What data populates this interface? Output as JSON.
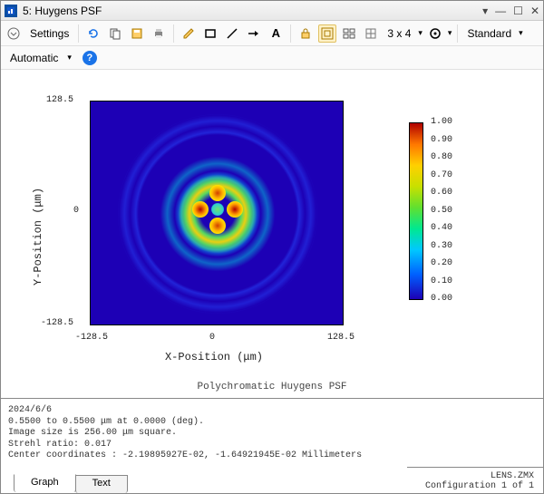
{
  "window": {
    "title": "5: Huygens PSF"
  },
  "toolbar": {
    "settings_label": "Settings",
    "grid_label": "3 x 4",
    "mode_label": "Standard",
    "automatic_label": "Automatic"
  },
  "tabs": {
    "graph": "Graph",
    "text": "Text"
  },
  "info": {
    "date": "2024/6/6",
    "wavelength_line": "0.5500 to 0.5500 μm at 0.0000 (deg).",
    "image_size_line": "Image size is 256.00 μm square.",
    "strehl_line": "Strehl ratio: 0.017",
    "center_line": "Center coordinates :  -2.19895927E-02,  -1.64921945E-02 Millimeters",
    "lens_file": "LENS.ZMX",
    "config_line": "Configuration 1 of 1"
  },
  "plot_caption": "Polychromatic Huygens PSF",
  "chart_data": {
    "type": "heatmap",
    "title": "Polychromatic Huygens PSF",
    "xlabel": "X-Position (μm)",
    "ylabel": "Y-Position (μm)",
    "xlim": [
      -128.5,
      128.5
    ],
    "ylim": [
      -128.5,
      128.5
    ],
    "xticks": [
      -128.5,
      0,
      128.5
    ],
    "yticks": [
      -128.5,
      0,
      128.5
    ],
    "colorbar": {
      "range": [
        0.0,
        1.0
      ],
      "ticks": [
        0.0,
        0.1,
        0.2,
        0.3,
        0.4,
        0.5,
        0.6,
        0.7,
        0.8,
        0.9,
        1.0
      ],
      "colormap": "jet"
    },
    "description": "Diffraction PSF intensity map: concentric interference rings centered near (0,0) with four bright inner lobes; background near 0, peak normalized to 1.0; Strehl ratio 0.017.",
    "peaks": [
      {
        "x": -18,
        "y": 0,
        "value": 1.0
      },
      {
        "x": 18,
        "y": 0,
        "value": 1.0
      },
      {
        "x": 0,
        "y": -18,
        "value": 0.95
      },
      {
        "x": 0,
        "y": 18,
        "value": 0.95
      },
      {
        "x": 0,
        "y": 0,
        "value": 0.6
      }
    ]
  }
}
